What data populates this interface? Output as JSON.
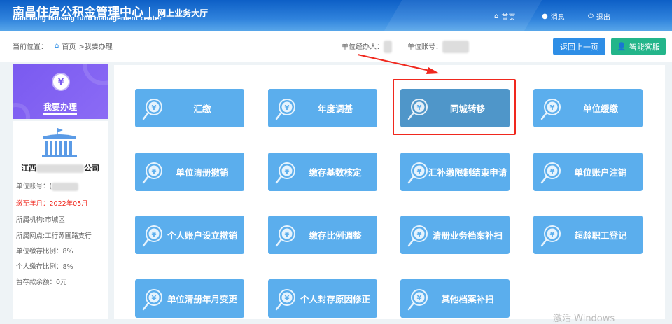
{
  "header": {
    "title": "南昌住房公积金管理中心",
    "divider": "|",
    "subtitle": "网上业务大厅",
    "english": "Nanchang housing fund management center",
    "nav": [
      {
        "label": "首页",
        "icon": "home-icon"
      },
      {
        "label": "消息",
        "icon": "message-icon"
      },
      {
        "label": "退出",
        "icon": "power-icon"
      }
    ]
  },
  "breadcrumb": {
    "prefix": "当前位置：",
    "home": "首页",
    "current": ">我要办理"
  },
  "unit_info": {
    "operator_label": "单位经办人：",
    "account_label": "单位账号："
  },
  "buttons": {
    "back": "返回上一页",
    "service": "智能客服"
  },
  "colors": {
    "back": "#2e8ee6",
    "service": "#23b58a",
    "tile": "#5baeed",
    "tile_selected": "#4f96c9",
    "sidebar_top": "#7a5af0",
    "highlight": "#f0281e"
  },
  "sidebar": {
    "title": "我要办理",
    "company_prefix": "江西",
    "company_suffix": "公司",
    "details": [
      {
        "text": "单位账号：("
      },
      {
        "text": "缴至年月：2022年05月",
        "highlight": true
      },
      {
        "text": "所属机构:市城区"
      },
      {
        "text": "所属网点:工行苏圃路支行"
      },
      {
        "text": "单位缴存比例：8%"
      },
      {
        "text": "个人缴存比例：8%"
      },
      {
        "text": "暂存款余额：0元"
      }
    ]
  },
  "tiles": [
    "汇缴",
    "年度调基",
    "同城转移",
    "单位缓缴",
    "单位清册撤销",
    "缴存基数核定",
    "汇补缴限制结束申请",
    "单位账户注销",
    "个人账户设立撤销",
    "缴存比例调整",
    "清册业务档案补扫",
    "超龄职工登记",
    "单位清册年月变更",
    "个人封存原因修正",
    "其他档案补扫"
  ],
  "selected_tile": "同城转移",
  "watermark": "激活 Windows"
}
